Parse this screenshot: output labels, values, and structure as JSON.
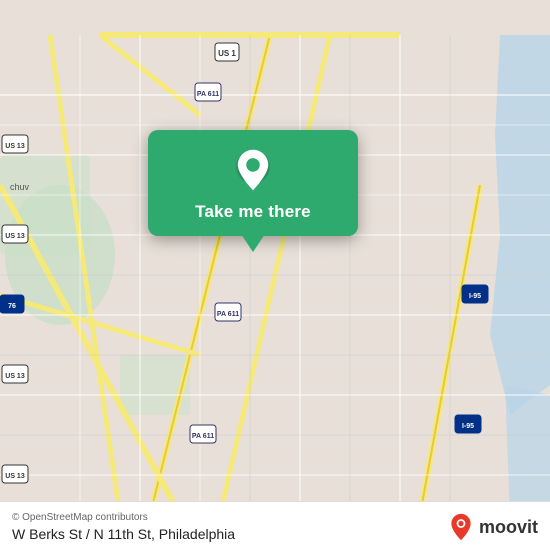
{
  "map": {
    "attribution": "© OpenStreetMap contributors",
    "location_label": "W Berks St / N 11th St, Philadelphia",
    "popup": {
      "button_label": "Take me there"
    }
  },
  "branding": {
    "moovit_text": "moovit"
  },
  "colors": {
    "popup_bg": "#2eaa6e",
    "map_bg": "#e8e0d8"
  }
}
